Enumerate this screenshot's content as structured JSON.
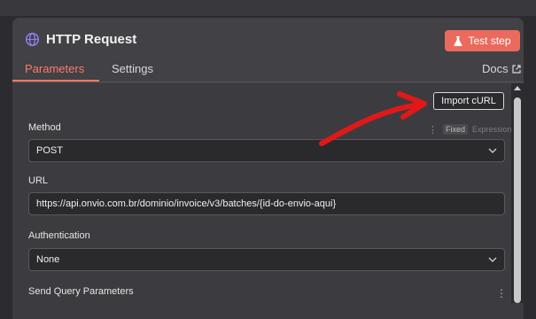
{
  "node": {
    "title": "HTTP Request",
    "test_button": "Test step",
    "tabs": [
      {
        "label": "Parameters",
        "active": true
      },
      {
        "label": "Settings",
        "active": false
      }
    ],
    "docs_link": "Docs"
  },
  "body": {
    "import_button": "Import cURL",
    "method": {
      "label": "Method",
      "value": "POST",
      "toggle": {
        "fixed": "Fixed",
        "expression": "Expression"
      }
    },
    "url": {
      "label": "URL",
      "value": "https://api.onvio.com.br/dominio/invoice/v3/batches/{id-do-envio-aqui}"
    },
    "authentication": {
      "label": "Authentication",
      "value": "None"
    },
    "send_query": {
      "label": "Send Query Parameters"
    }
  },
  "colors": {
    "accent": "#ff7a6a",
    "test_button": "#ea6b5d",
    "annotation_arrow": "#e21818"
  },
  "icons": [
    "globe-icon",
    "flask-icon",
    "external-link-icon",
    "chevron-down-icon",
    "kebab-icon",
    "scroll-up-icon"
  ]
}
